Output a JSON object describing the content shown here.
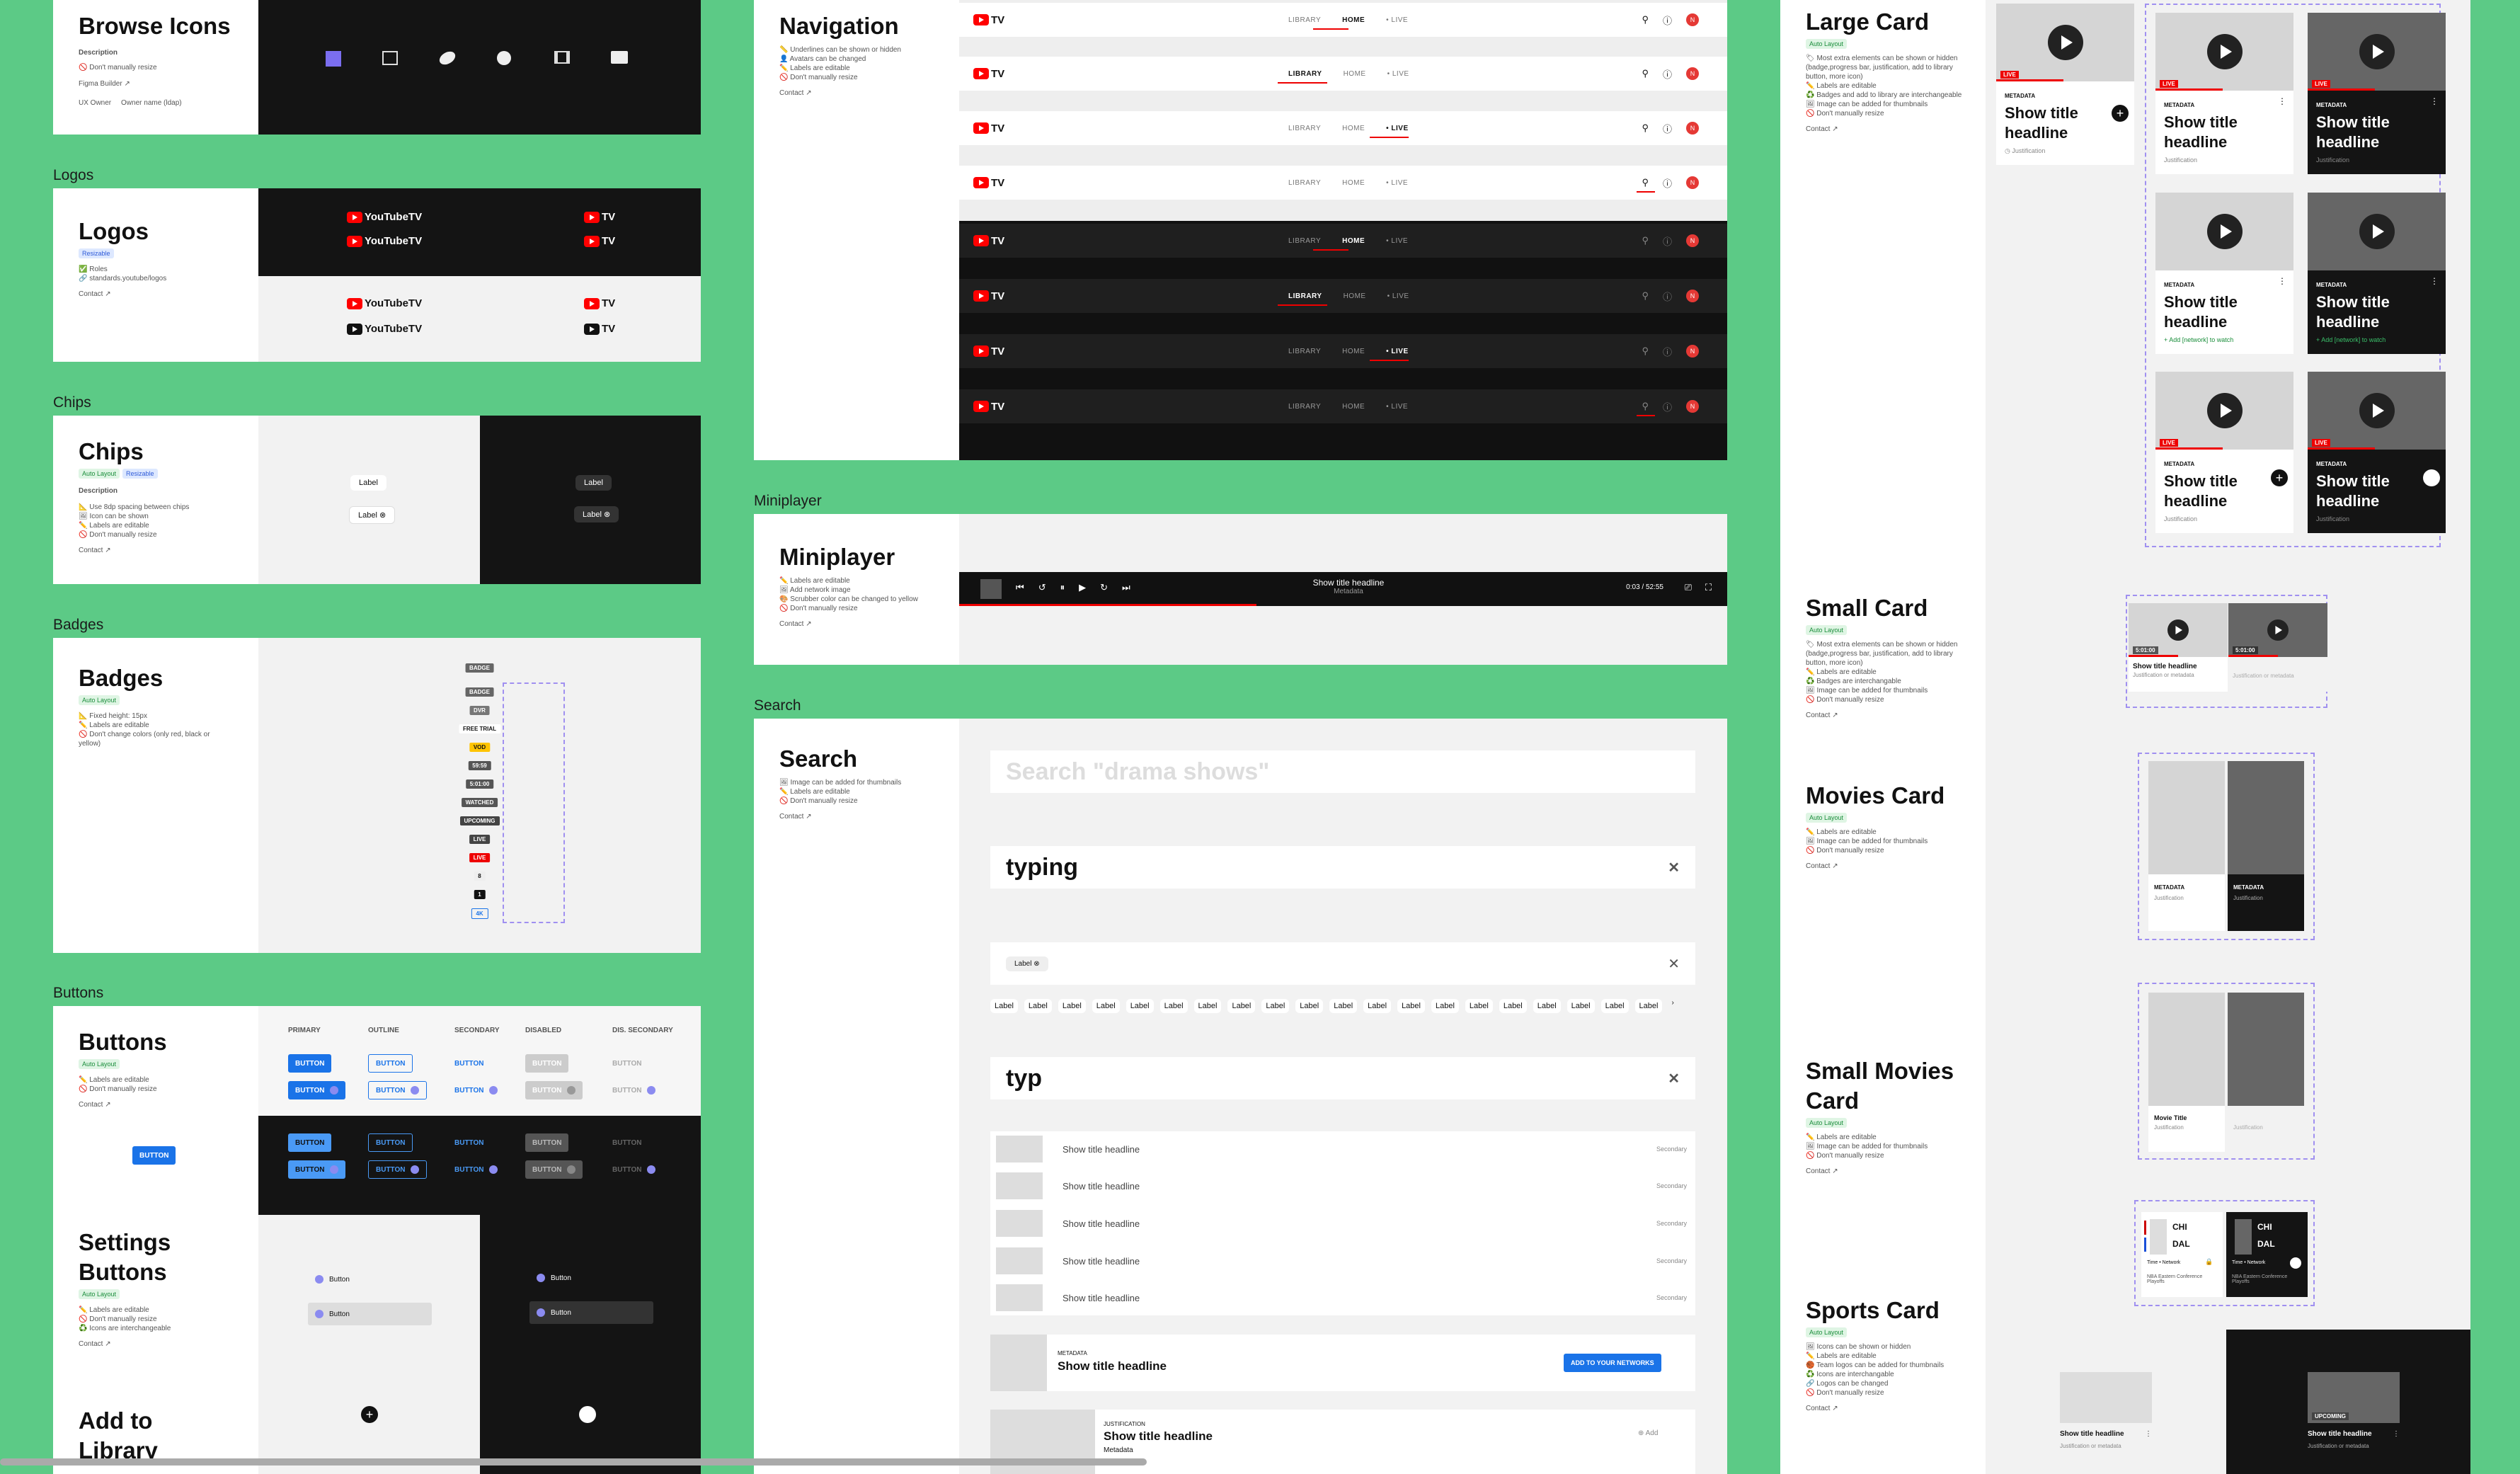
{
  "sections": {
    "logos": "Logos",
    "chips": "Chips",
    "badges": "Badges",
    "buttons": "Buttons",
    "miniplayer": "Miniplayer",
    "search": "Search"
  },
  "browse_icons": {
    "title": "Browse Icons",
    "description": "Description",
    "note": "🚫 Don't manually resize",
    "figma": "Figma Builder ↗",
    "ux_owner_label": "UX Owner",
    "ux_owner_value": "Owner name (ldap)"
  },
  "logos_panel": {
    "title": "Logos",
    "tag": "Resizable",
    "notes": [
      "✅ Roles",
      "🔗 standards.youtube/logos"
    ],
    "contact": "Contact ↗",
    "full": "YouTubeTV",
    "short": "TV"
  },
  "chips_panel": {
    "title": "Chips",
    "tags": [
      "Auto Layout",
      "Resizable"
    ],
    "description": "Description",
    "notes": [
      "📐 Use 8dp spacing between chips",
      "🖼 Icon can be shown",
      "✏️ Labels are editable",
      "🚫 Don't manually resize"
    ],
    "contact": "Contact ↗",
    "chip": "Label"
  },
  "badges_panel": {
    "title": "Badges",
    "tag": "Auto Layout",
    "notes": [
      "📐 Fixed height: 15px",
      "✏️ Labels are editable",
      "🚫 Don't change colors (only red, black or yellow)"
    ],
    "badges": [
      "BADGE",
      "BADGE",
      "DVR",
      "FREE TRIAL",
      "VOD",
      "59:59",
      "5:01:00",
      "WATCHED",
      "UPCOMING",
      "LIVE",
      "LIVE",
      "8",
      "1",
      "4K"
    ]
  },
  "buttons_panel": {
    "title": "Buttons",
    "tag": "Auto Layout",
    "notes": [
      "✏️ Labels are editable",
      "🚫 Don't manually resize"
    ],
    "contact": "Contact ↗",
    "columns": [
      "PRIMARY",
      "OUTLINE",
      "SECONDARY",
      "DISABLED",
      "DIS. SECONDARY"
    ],
    "label": "BUTTON"
  },
  "settings_buttons": {
    "title": "Settings Buttons",
    "tag": "Auto Layout",
    "notes": [
      "✏️ Labels are editable",
      "🚫 Don't manually resize",
      "♻️ Icons are interchangeable"
    ],
    "contact": "Contact ↗",
    "label": "Button"
  },
  "add_to_library": {
    "title": "Add to Library"
  },
  "navigation": {
    "title": "Navigation",
    "notes": [
      "📏 Underlines can be shown or hidden",
      "👤 Avatars can be changed",
      "✏️ Labels are editable",
      "🚫 Don't manually resize"
    ],
    "contact": "Contact ↗",
    "links": [
      "LIBRARY",
      "HOME",
      "• LIVE"
    ],
    "logo": "TV",
    "avatar": "N"
  },
  "miniplayer_panel": {
    "title": "Miniplayer",
    "notes": [
      "✏️ Labels are editable",
      "🖼 Add network image",
      "🎨 Scrubber color can be changed to yellow",
      "🚫 Don't manually resize"
    ],
    "contact": "Contact ↗",
    "headline": "Show title headline",
    "metadata": "Metadata",
    "time": "0:03 / 52:55"
  },
  "search_panel": {
    "title": "Search",
    "notes": [
      "🖼 Image can be added for thumbnails",
      "✏️ Labels are editable",
      "🚫 Don't manually resize"
    ],
    "contact": "Contact ↗",
    "placeholder": "Search \"drama shows\"",
    "typing": "typing",
    "chip": "Label",
    "suggest": "Label",
    "typ": "typ",
    "result": "Show title headline",
    "secondary": "Secondary",
    "meta_small": "METADATA",
    "add_network": "ADD TO YOUR NETWORKS",
    "justification": "JUSTIFICATION",
    "metadata": "Metadata",
    "add": "Add"
  },
  "large_card": {
    "title": "Large Card",
    "tag": "Auto Layout",
    "notes": [
      "🏷 Most extra elements can be shown or hidden (badge,progress bar, justification, add to library button, more icon)",
      "✏️ Labels are editable",
      "♻️ Badges and add to library are interchangeable",
      "🖼 Image can be added for thumbnails",
      "🚫 Don't manually resize"
    ],
    "contact": "Contact ↗",
    "meta": "METADATA",
    "headline": "Show title headline",
    "just": "Justification",
    "add_network": "+ Add [network] to watch",
    "live": "LIVE"
  },
  "small_card": {
    "title": "Small Card",
    "tag": "Auto Layout",
    "notes": [
      "🏷 Most extra elements can be shown or hidden (badge,progress bar, justification, add to library button, more icon)",
      "✏️ Labels are editable",
      "♻️ Badges are interchangable",
      "🖼 Image can be added for thumbnails",
      "🚫 Don't manually resize"
    ],
    "contact": "Contact ↗",
    "headline": "Show title headline",
    "just": "Justification or metadata",
    "time": "5:01:00"
  },
  "movies_card": {
    "title": "Movies Card",
    "tag": "Auto Layout",
    "notes": [
      "✏️ Labels are editable",
      "🖼 Image can be added for thumbnails",
      "🚫 Don't manually resize"
    ],
    "contact": "Contact ↗",
    "meta": "METADATA",
    "just": "Justification"
  },
  "small_movies_card": {
    "title": "Small Movies Card",
    "tag": "Auto Layout",
    "notes": [
      "✏️ Labels are editable",
      "🖼 Image can be added for thumbnails",
      "🚫 Don't manually resize"
    ],
    "contact": "Contact ↗",
    "movie_title": "Movie Title",
    "just": "Justification"
  },
  "sports_card": {
    "title": "Sports Card",
    "tag": "Auto Layout",
    "notes": [
      "🖼 Icons can be shown or hidden",
      "✏️ Labels are editable",
      "🏀 Team logos can be added for thumbnails",
      "♻️ Icons are interchangable",
      "🔗 Logos can be changed",
      "🚫 Don't manually resize"
    ],
    "contact": "Contact ↗",
    "team1": "CHI",
    "team2": "DAL",
    "time": "Time • Network",
    "event": "NBA Eastern Conference Playoffs",
    "headline": "Show title headline",
    "just": "Justification or metadata",
    "upcoming": "UPCOMING"
  },
  "colors": {
    "green": "#5cca86",
    "blue": "#1a73e8",
    "red": "#e00000",
    "dark": "#141414",
    "dash": "#a090f0"
  }
}
